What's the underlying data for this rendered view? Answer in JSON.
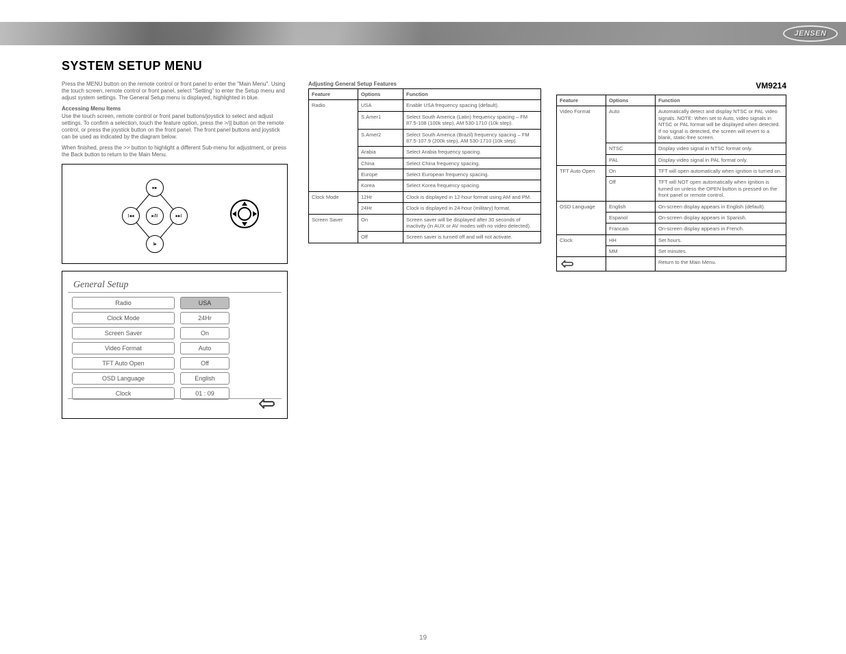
{
  "brand": "JENSEN",
  "model": "VM9214",
  "page_title": "SYSTEM SETUP MENU",
  "page_number": "19",
  "intro_paragraphs": [
    "Press the MENU button on the remote control or front panel to enter the \"Main Menu\". Using the touch screen, remote control or front panel, select \"Setting\" to enter the Setup menu and adjust system settings. The General Setup menu is displayed, highlighted in blue."
  ],
  "access_heading": "Accessing Menu Items",
  "access_paragraphs": [
    "Use the touch screen, remote control or front panel buttons/joystick to select and adjust settings. To confirm a selection, touch the feature option, press the >/|| button on the remote control, or press the joystick button on the front panel. The front panel buttons and joystick can be used as indicated by the diagram below.",
    "When finished, press the >> button to highlight a different Sub-menu for adjustment, or press the Back button to return to the Main Menu."
  ],
  "dpad_labels": {
    "up": "▸▸",
    "left": "I◂◂",
    "center": "▸/II",
    "right": "▸▸I",
    "down": "I▸"
  },
  "gs_title": "General Setup",
  "general_setup_rows": [
    {
      "label": "Radio",
      "value": "USA",
      "active": true
    },
    {
      "label": "Clock Mode",
      "value": "24Hr",
      "active": false
    },
    {
      "label": "Screen Saver",
      "value": "On",
      "active": false
    },
    {
      "label": "Video Format",
      "value": "Auto",
      "active": false
    },
    {
      "label": "TFT Auto Open",
      "value": "Off",
      "active": false
    },
    {
      "label": "OSD Language",
      "value": "English",
      "active": false
    },
    {
      "label": "Clock",
      "value": "01 : 09",
      "active": false
    }
  ],
  "mid_heading": "Adjusting General Setup Features",
  "mid_table_head": [
    "Feature",
    "Options",
    "Function"
  ],
  "mid_table": [
    {
      "feature": "Radio",
      "rows": [
        {
          "option": "USA",
          "function": "Enable USA frequency spacing (default)."
        },
        {
          "option": "S.Amer1",
          "function": "Select South America (Latin) frequency spacing – FM 87.5-108 (100k step), AM 530-1710 (10k step)."
        },
        {
          "option": "S.Amer2",
          "function": "Select South America (Brazil) frequency spacing – FM 87.5-107.9 (200k step), AM 530-1710 (10k step)."
        },
        {
          "option": "Arabia",
          "function": "Select Arabia frequency spacing."
        },
        {
          "option": "China",
          "function": "Select China frequency spacing."
        },
        {
          "option": "Europe",
          "function": "Select European frequency spacing."
        },
        {
          "option": "Korea",
          "function": "Select Korea frequency spacing."
        }
      ]
    },
    {
      "feature": "Clock Mode",
      "rows": [
        {
          "option": "12Hr",
          "function": "Clock is displayed in 12-hour format using AM and PM."
        },
        {
          "option": "24Hr",
          "function": "Clock is displayed in 24-hour (military) format."
        }
      ]
    },
    {
      "feature": "Screen Saver",
      "rows": [
        {
          "option": "On",
          "function": "Screen saver will be displayed after 30 seconds of inactivity (in AUX or AV modes with no video detected)."
        },
        {
          "option": "Off",
          "function": "Screen saver is turned off and will not activate."
        }
      ]
    }
  ],
  "right_table_head": [
    "Feature",
    "Options",
    "Function"
  ],
  "right_table": [
    {
      "feature": "Video Format",
      "rows": [
        {
          "option": "Auto",
          "function": "Automatically detect and display NTSC or PAL video signals.\nNOTE: When set to Auto, video signals in NTSC or PAL format will be displayed when detected. If no signal is detected, the screen will revert to a blank, static-free screen."
        },
        {
          "option": "NTSC",
          "function": "Display video signal in NTSC format only."
        },
        {
          "option": "PAL",
          "function": "Display video signal in PAL format only."
        }
      ]
    },
    {
      "feature": "TFT Auto Open",
      "rows": [
        {
          "option": "On",
          "function": "TFT will open automatically when ignition is turned on."
        },
        {
          "option": "Off",
          "function": "TFT will NOT open automatically when ignition is turned on unless the OPEN button is pressed on the front panel or remote control."
        }
      ]
    },
    {
      "feature": "OSD Language",
      "rows": [
        {
          "option": "English",
          "function": "On-screen display appears in English (default)."
        },
        {
          "option": "Espanol",
          "function": "On-screen display appears in Spanish."
        },
        {
          "option": "Francais",
          "function": "On-screen display appears in French."
        }
      ]
    },
    {
      "feature": "Clock",
      "rows": [
        {
          "option": "HH",
          "function": "Set hours."
        },
        {
          "option": "MM",
          "function": "Set minutes."
        }
      ]
    },
    {
      "feature": "__back__",
      "rows": [
        {
          "option": "",
          "function": "Return to the Main Menu."
        }
      ]
    }
  ]
}
